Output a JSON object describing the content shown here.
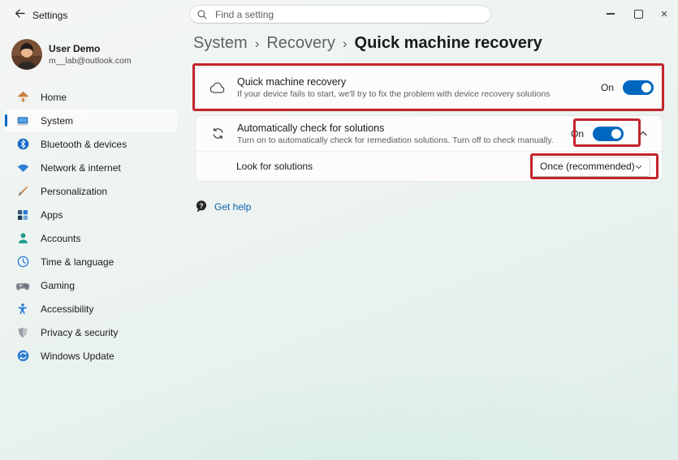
{
  "titlebar": {
    "app_title": "Settings",
    "search_placeholder": "Find a setting"
  },
  "profile": {
    "name": "User Demo",
    "email": "m__lab@outlook.com"
  },
  "sidebar": {
    "items": [
      {
        "label": "Home",
        "icon": "home-icon"
      },
      {
        "label": "System",
        "icon": "system-icon",
        "selected": true
      },
      {
        "label": "Bluetooth & devices",
        "icon": "bluetooth-icon"
      },
      {
        "label": "Network & internet",
        "icon": "network-icon"
      },
      {
        "label": "Personalization",
        "icon": "personalization-icon"
      },
      {
        "label": "Apps",
        "icon": "apps-icon"
      },
      {
        "label": "Accounts",
        "icon": "accounts-icon"
      },
      {
        "label": "Time & language",
        "icon": "time-language-icon"
      },
      {
        "label": "Gaming",
        "icon": "gaming-icon"
      },
      {
        "label": "Accessibility",
        "icon": "accessibility-icon"
      },
      {
        "label": "Privacy & security",
        "icon": "privacy-security-icon"
      },
      {
        "label": "Windows Update",
        "icon": "windows-update-icon"
      }
    ]
  },
  "breadcrumb": {
    "level1": "System",
    "level2": "Recovery",
    "level3": "Quick machine recovery",
    "separator": "›"
  },
  "content": {
    "quick_recovery": {
      "title": "Quick machine recovery",
      "subtitle": "If your device fails to start, we'll try to fix the problem with device recovery solutions",
      "toggle_state": "On"
    },
    "auto_check": {
      "title": "Automatically check for solutions",
      "subtitle": "Turn on to automatically check for remediation solutions. Turn off to check manually.",
      "toggle_state": "On"
    },
    "look_for_solutions": {
      "label": "Look for solutions",
      "selected_option": "Once (recommended)"
    },
    "get_help_label": "Get help"
  },
  "colors": {
    "accent_blue": "#0067c0",
    "annotation_red": "#c3242b",
    "link_blue": "#0f62ae"
  }
}
